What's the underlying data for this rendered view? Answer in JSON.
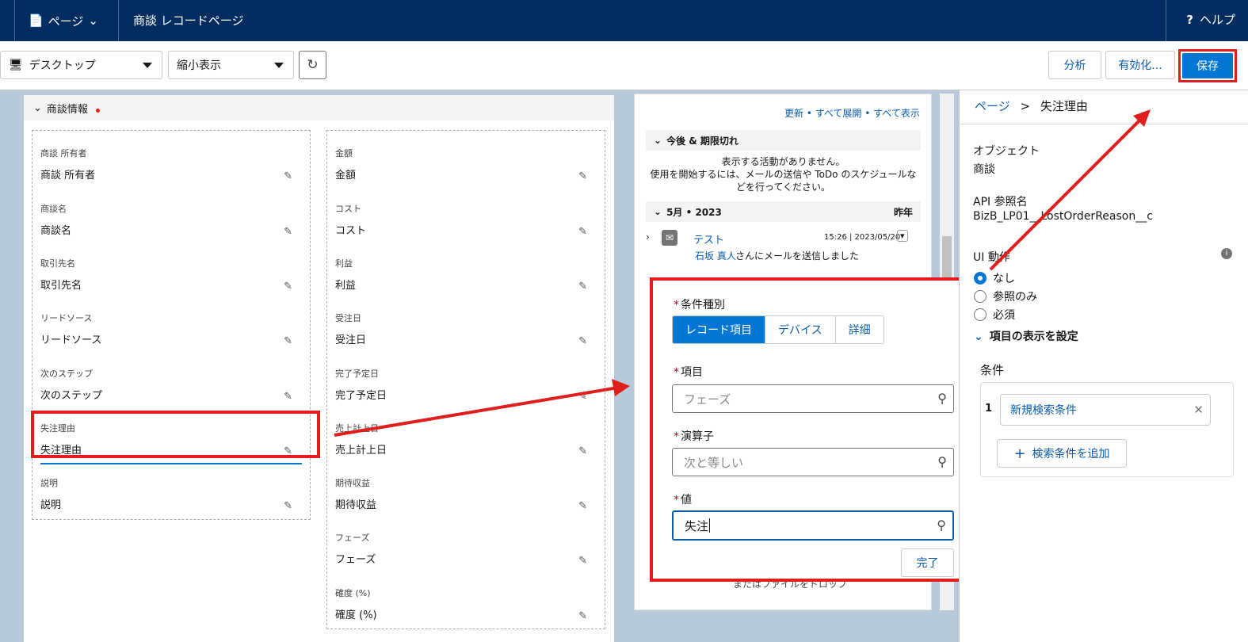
{
  "topbar": {
    "page_menu": "ページ",
    "title": "商談 レコードページ",
    "help": "ヘルプ"
  },
  "toolbar": {
    "device": "デスクトップ",
    "zoom": "縮小表示",
    "analyze": "分析",
    "activate": "有効化...",
    "save": "保存"
  },
  "section": {
    "title": "商談情報"
  },
  "left_fields": [
    {
      "label": "商談 所有者",
      "value": "商談 所有者"
    },
    {
      "label": "商談名",
      "value": "商談名"
    },
    {
      "label": "取引先名",
      "value": "取引先名"
    },
    {
      "label": "リードソース",
      "value": "リードソース"
    },
    {
      "label": "次のステップ",
      "value": "次のステップ"
    },
    {
      "label": "失注理由",
      "value": "失注理由"
    },
    {
      "label": "説明",
      "value": "説明"
    }
  ],
  "right_fields": [
    {
      "label": "金額",
      "value": "金額"
    },
    {
      "label": "コスト",
      "value": "コスト"
    },
    {
      "label": "利益",
      "value": "利益"
    },
    {
      "label": "受注日",
      "value": "受注日"
    },
    {
      "label": "完了予定日",
      "value": "完了予定日"
    },
    {
      "label": "売上計上日",
      "value": "売上計上日"
    },
    {
      "label": "期待収益",
      "value": "期待収益"
    },
    {
      "label": "フェーズ",
      "value": "フェーズ"
    },
    {
      "label": "確度 (%)",
      "value": "確度 (%)"
    }
  ],
  "activity": {
    "link_refresh": "更新",
    "link_expand": "すべて展開",
    "link_showall": "すべて表示",
    "upcoming": "今後 & 期限切れ",
    "no_activity_1": "表示する活動がありません。",
    "no_activity_2": "使用を開始するには、メールの送信や ToDo のスケジュールなどを行ってください。",
    "month": "5月 • 2023",
    "last_year": "昨年",
    "email_subject": "テスト",
    "email_time": "15:26 | 2023/05/20",
    "email_sender": "石坂 真人",
    "email_text": "さんにメールを送信しました",
    "drop_text": "またはファイルをドロップ"
  },
  "popover": {
    "cond_type_label": "条件種別",
    "cond_types": [
      "レコード項目",
      "デバイス",
      "詳細"
    ],
    "field_label": "項目",
    "field_value": "フェーズ",
    "operator_label": "演算子",
    "operator_value": "次と等しい",
    "value_label": "値",
    "value_value": "失注",
    "done": "完了"
  },
  "props": {
    "crumb_page": "ページ",
    "crumb_sep": ">",
    "crumb_current": "失注理由",
    "object_label": "オブジェクト",
    "object_value": "商談",
    "api_label": "API 参照名",
    "api_value": "BizB_LP01__LostOrderReason__c",
    "ui_label": "UI 動作",
    "ui_options": [
      "なし",
      "参照のみ",
      "必須"
    ],
    "visibility": "項目の表示を設定",
    "conditions": "条件",
    "cond_index": "1",
    "cond_new": "新規検索条件",
    "add_cond": "検索条件を追加"
  },
  "colors": {
    "nav": "#032d60",
    "brand": "#0176d3",
    "highlight": "#e01e1e"
  }
}
